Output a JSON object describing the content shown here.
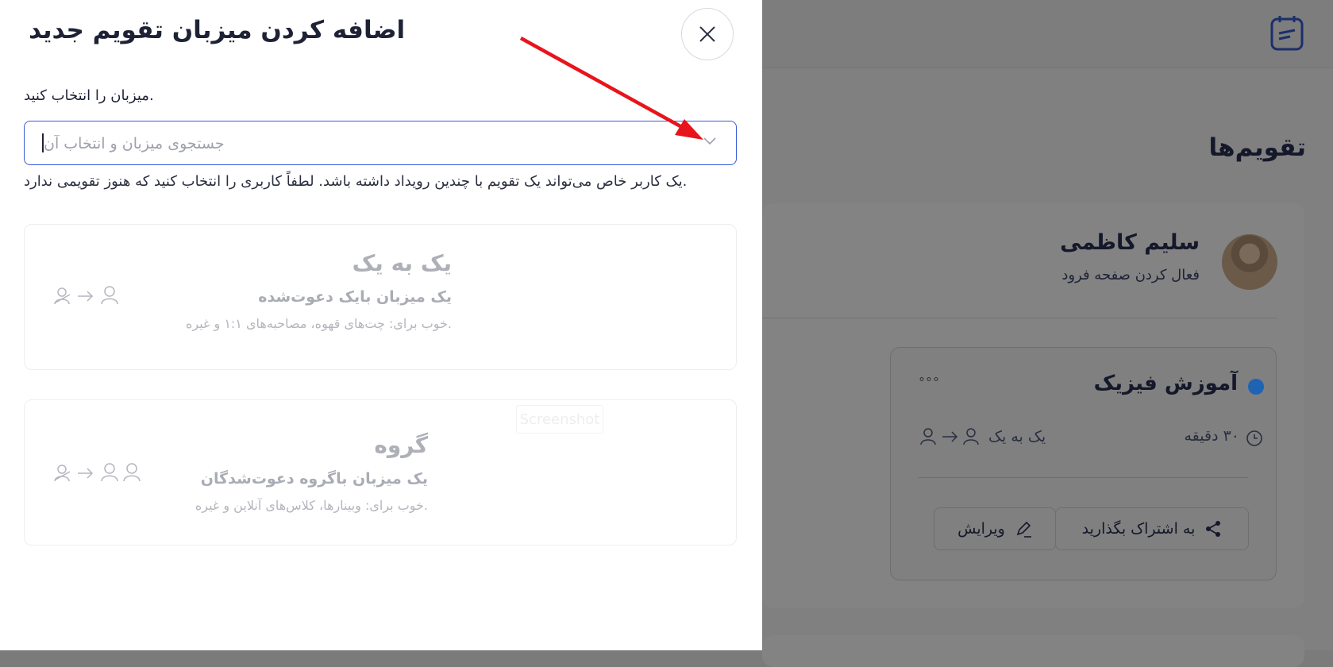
{
  "background": {
    "page_title": "تقویم‌ها",
    "user": {
      "name": "سلیم کاظمی",
      "subtitle": "فعال کردن صفحه فرود"
    },
    "event": {
      "title": "آموزش فیزیک",
      "duration": "۳۰ دقیقه",
      "type": "یک به یک",
      "share_label": "به اشتراک بگذارید",
      "edit_label": "ویرایش",
      "more_label": "°°°"
    }
  },
  "drawer": {
    "title": "اضافه کردن میزبان تقویم جدید",
    "field_label": ".میزبان را انتخاب کنید",
    "search_placeholder": "جستجوی میزبان و انتخاب آن",
    "helper_text": ".یک کاربر خاص می‌تواند یک تقویم با چندین رویداد داشته باشد. لطفاً کاربری را انتخاب کنید که هنوز تقویمی ندارد",
    "options": [
      {
        "title": "یک به یک",
        "subtitle": "یک میزبان بایک دعوت‌شده",
        "note": ".خوب برای: چت‌های قهوه، مصاحبه‌های ۱:۱ و غیره"
      },
      {
        "title": "گروه",
        "subtitle": "یک میزبان باگروه دعوت‌شدگان",
        "note": ".خوب برای: وبینارها، کلاس‌های آنلاین و غیره"
      }
    ],
    "watermark": "Screenshot"
  },
  "colors": {
    "accent": "#3b5bd6",
    "arrow": "#e8141c",
    "dot": "#1f63b4"
  }
}
